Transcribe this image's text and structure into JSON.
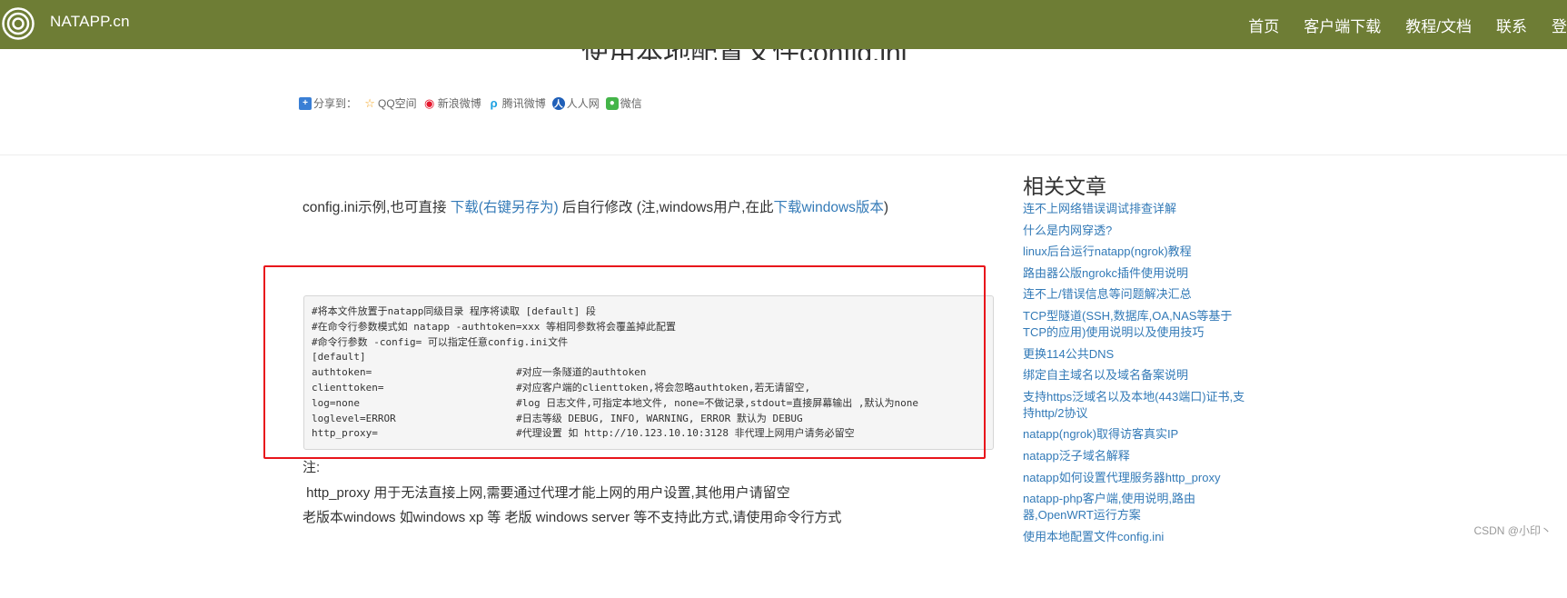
{
  "navbar": {
    "brand": "NATAPP.cn",
    "logo_icon": "target-logo-icon",
    "color": "#6e7d35",
    "links": [
      "首页",
      "客户端下载",
      "教程/文档",
      "联系",
      "登"
    ]
  },
  "page_title": "使用本地配置文件config.ini",
  "share": {
    "label": "分享到：",
    "items": [
      {
        "label": "QQ空间",
        "icon": "qzone-icon",
        "color": "#f5a623"
      },
      {
        "label": "新浪微博",
        "icon": "weibo-icon",
        "color": "#e6162d"
      },
      {
        "label": "腾讯微博",
        "icon": "tencent-weibo-icon",
        "color": "#1ba0e1"
      },
      {
        "label": "人人网",
        "icon": "renren-icon",
        "color": "#1f5fb8"
      },
      {
        "label": "微信",
        "icon": "wechat-icon",
        "color": "#44b549"
      }
    ]
  },
  "intro": {
    "text1": "config.ini示例,也可直接 ",
    "link1": "下载(右键另存为)",
    "text2": " 后自行修改 (注,windows用户,在此",
    "link2": "下载windows版本",
    "text3": ")"
  },
  "code_lines": [
    "#将本文件放置于natapp同级目录 程序将读取 [default] 段",
    "#在命令行参数模式如 natapp -authtoken=xxx 等相同参数将会覆盖掉此配置",
    "#命令行参数 -config= 可以指定任意config.ini文件",
    "[default]",
    "authtoken=                        #对应一条隧道的authtoken",
    "clienttoken=                      #对应客户端的clienttoken,将会忽略authtoken,若无请留空,",
    "log=none                          #log 日志文件,可指定本地文件, none=不做记录,stdout=直接屏幕输出 ,默认为none",
    "loglevel=ERROR                    #日志等级 DEBUG, INFO, WARNING, ERROR 默认为 DEBUG",
    "http_proxy=                       #代理设置 如 http://10.123.10.10:3128 非代理上网用户请务必留空"
  ],
  "notes": [
    "注:",
    " http_proxy 用于无法直接上网,需要通过代理才能上网的用户设置,其他用户请留空",
    "老版本windows 如windows xp 等 老版 windows server 等不支持此方式,请使用命令行方式"
  ],
  "sidebar": {
    "title": "相关文章",
    "items": [
      "连不上网络错误调试排查详解",
      "什么是内网穿透?",
      "linux后台运行natapp(ngrok)教程",
      "路由器公版ngrokc插件使用说明",
      "连不上/错误信息等问题解决汇总",
      "TCP型隧道(SSH,数据库,OA,NAS等基于TCP的应用)使用说明以及使用技巧",
      "更换114公共DNS",
      "绑定自主域名以及域名备案说明",
      "支持https泛域名以及本地(443端口)证书,支持http/2协议",
      "natapp(ngrok)取得访客真实IP",
      "natapp泛子域名解释",
      "natapp如何设置代理服务器http_proxy",
      "natapp-php客户端,使用说明,路由器,OpenWRT运行方案",
      "使用本地配置文件config.ini"
    ]
  },
  "watermark": "CSDN @小印丶",
  "highlight_color": "#e8151b"
}
